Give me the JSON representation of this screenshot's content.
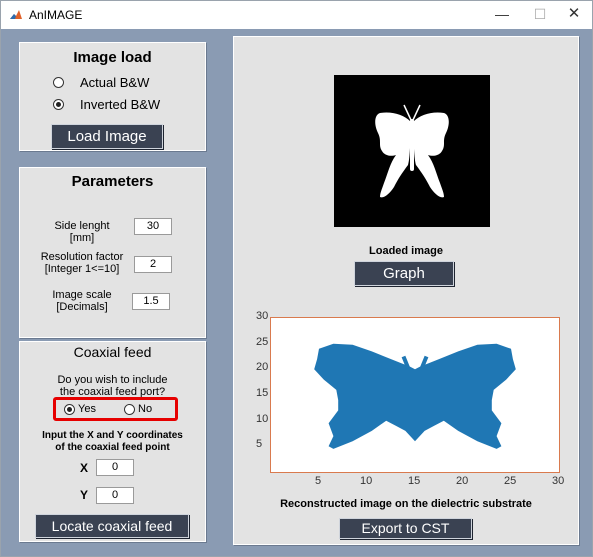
{
  "window": {
    "title": "AnIMAGE",
    "minimize": "—",
    "maximize": "☐",
    "close": "✕"
  },
  "image_load": {
    "title": "Image load",
    "options": [
      {
        "label": "Actual B&W",
        "selected": false
      },
      {
        "label": "Inverted B&W",
        "selected": true
      }
    ],
    "button": "Load Image"
  },
  "parameters": {
    "title": "Parameters",
    "fields": [
      {
        "label_line1": "Side lenght",
        "label_line2": "[mm]",
        "value": "30"
      },
      {
        "label_line1": "Resolution factor",
        "label_line2": "[Integer 1<=10]",
        "value": "2"
      },
      {
        "label_line1": "Image scale",
        "label_line2": "[Decimals]",
        "value": "1.5"
      }
    ]
  },
  "coaxial_feed": {
    "title": "Coaxial feed",
    "question_line1": "Do you wish to include",
    "question_line2": "the coaxial feed port?",
    "options": [
      {
        "label": "Yes",
        "selected": true
      },
      {
        "label": "No",
        "selected": false
      }
    ],
    "instr_line1": "Input the X and Y coordinates",
    "instr_line2": "of the coaxial feed point",
    "x_label": "X",
    "x_value": "0",
    "y_label": "Y",
    "y_value": "0",
    "button": "Locate coaxial feed"
  },
  "right_panel": {
    "loaded_caption": "Loaded image",
    "graph_button": "Graph",
    "plot_caption": "Reconstructed image on the dielectric substrate",
    "export_button": "Export to CST"
  },
  "chart_data": {
    "type": "scatter",
    "title": "",
    "xlabel": "",
    "ylabel": "",
    "xlim": [
      0,
      30
    ],
    "ylim": [
      0,
      30
    ],
    "xticks": [
      "5",
      "10",
      "15",
      "20",
      "25",
      "30"
    ],
    "yticks": [
      "5",
      "10",
      "15",
      "20",
      "25",
      "30"
    ],
    "series": [
      {
        "shape": "butterfly",
        "color": "#1f77b4"
      }
    ],
    "frame_color": "#d97a4e"
  }
}
